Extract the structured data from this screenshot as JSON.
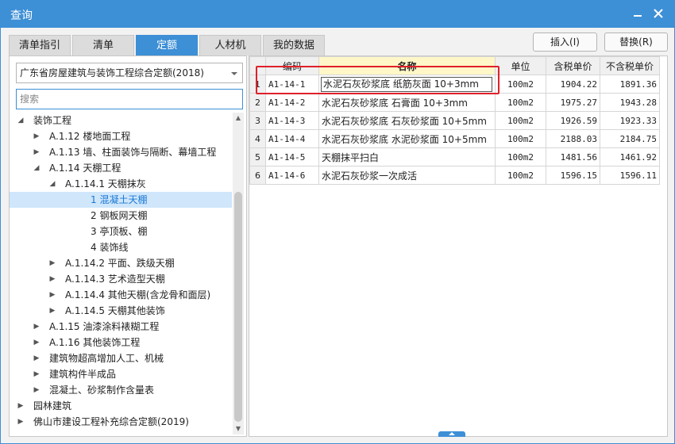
{
  "window": {
    "title": "查询"
  },
  "tabs": [
    {
      "label": "清单指引"
    },
    {
      "label": "清单"
    },
    {
      "label": "定额"
    },
    {
      "label": "人材机"
    },
    {
      "label": "我的数据"
    }
  ],
  "actions": {
    "insert": "插入(I)",
    "replace": "替换(R)"
  },
  "left": {
    "quota_library": "广东省房屋建筑与装饰工程综合定额(2018)",
    "search_placeholder": "搜索",
    "tree": [
      {
        "label": "装饰工程",
        "level": 1,
        "expanded": true
      },
      {
        "label": "A.1.12 楼地面工程",
        "level": 2,
        "expanded": false
      },
      {
        "label": "A.1.13 墙、柱面装饰与隔断、幕墙工程",
        "level": 2,
        "expanded": false
      },
      {
        "label": "A.1.14 天棚工程",
        "level": 2,
        "expanded": true
      },
      {
        "label": "A.1.14.1 天棚抹灰",
        "level": 3,
        "expanded": true
      },
      {
        "label": "1 混凝土天棚",
        "level": 4,
        "selected": true
      },
      {
        "label": "2 钢板网天棚",
        "level": 4
      },
      {
        "label": "3 亭顶板、棚",
        "level": 4
      },
      {
        "label": "4 装饰线",
        "level": 4
      },
      {
        "label": "A.1.14.2 平面、跌级天棚",
        "level": 3,
        "expanded": false
      },
      {
        "label": "A.1.14.3 艺术造型天棚",
        "level": 3,
        "expanded": false
      },
      {
        "label": "A.1.14.4 其他天棚(含龙骨和面层)",
        "level": 3,
        "expanded": false
      },
      {
        "label": "A.1.14.5 天棚其他装饰",
        "level": 3,
        "expanded": false
      },
      {
        "label": "A.1.15 油漆涂料裱糊工程",
        "level": 2,
        "expanded": false
      },
      {
        "label": "A.1.16 其他装饰工程",
        "level": 2,
        "expanded": false
      },
      {
        "label": "建筑物超高增加人工、机械",
        "level": 2,
        "expanded": false
      },
      {
        "label": "建筑构件半成品",
        "level": 2,
        "expanded": false
      },
      {
        "label": "混凝土、砂浆制作含量表",
        "level": 2,
        "expanded": false
      },
      {
        "label": "园林建筑",
        "level": 1,
        "expanded": false
      },
      {
        "label": "佛山市建设工程补充综合定额(2019)",
        "level": 1,
        "expanded": false
      }
    ]
  },
  "table": {
    "headers": [
      "编码",
      "名称",
      "单位",
      "含税单价",
      "不含税单价"
    ],
    "rows": [
      {
        "idx": "1",
        "code": "A1-14-1",
        "name": "水泥石灰砂浆底 纸筋灰面 10+3mm",
        "unit": "100m2",
        "price_tax": "1904.22",
        "price_notax": "1891.36"
      },
      {
        "idx": "2",
        "code": "A1-14-2",
        "name": "水泥石灰砂浆底 石膏面 10+3mm",
        "unit": "100m2",
        "price_tax": "1975.27",
        "price_notax": "1943.28"
      },
      {
        "idx": "3",
        "code": "A1-14-3",
        "name": "水泥石灰砂浆底 石灰砂浆面 10+5mm",
        "unit": "100m2",
        "price_tax": "1926.59",
        "price_notax": "1923.33"
      },
      {
        "idx": "4",
        "code": "A1-14-4",
        "name": "水泥石灰砂浆底 水泥砂浆面 10+5mm",
        "unit": "100m2",
        "price_tax": "2188.03",
        "price_notax": "2184.75"
      },
      {
        "idx": "5",
        "code": "A1-14-5",
        "name": "天棚抹平扫白",
        "unit": "100m2",
        "price_tax": "1481.56",
        "price_notax": "1461.92"
      },
      {
        "idx": "6",
        "code": "A1-14-6",
        "name": "水泥石灰砂浆一次成活",
        "unit": "100m2",
        "price_tax": "1596.15",
        "price_notax": "1596.11"
      }
    ]
  }
}
